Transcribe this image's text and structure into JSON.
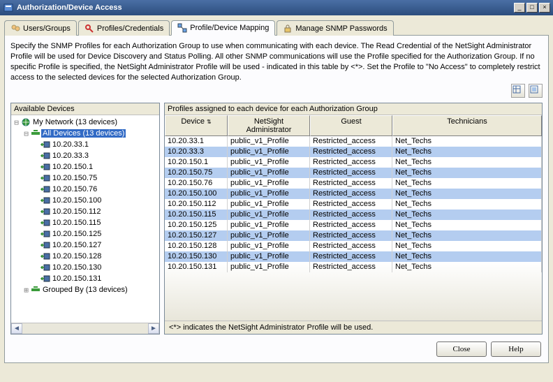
{
  "window": {
    "title": "Authorization/Device Access"
  },
  "tabs": [
    {
      "label": "Users/Groups"
    },
    {
      "label": "Profiles/Credentials"
    },
    {
      "label": "Profile/Device Mapping"
    },
    {
      "label": "Manage SNMP Passwords"
    }
  ],
  "description": "Specify the SNMP Profiles for each Authorization Group to use when communicating with each device.  The Read Credential of the NetSight Administrator Profile will be used for Device Discovery and Status Polling.  All other SNMP communications will use the Profile specified for the Authorization Group.  If no specific Profile is specified, the NetSight Administrator Profile will be used - indicated in this table by <*>.  Set the Profile to \"No Access\" to completely restrict access to the selected devices for the selected Authorization Group.",
  "left_header": "Available Devices",
  "right_header": "Profiles assigned to each device for each Authorization Group",
  "tree": {
    "root": "My Network (13 devices)",
    "all_devices": "All Devices (13 devices)",
    "devices": [
      "10.20.33.1",
      "10.20.33.3",
      "10.20.150.1",
      "10.20.150.75",
      "10.20.150.76",
      "10.20.150.100",
      "10.20.150.112",
      "10.20.150.115",
      "10.20.150.125",
      "10.20.150.127",
      "10.20.150.128",
      "10.20.150.130",
      "10.20.150.131"
    ],
    "grouped_by": "Grouped By (13 devices)"
  },
  "grid": {
    "headers": [
      "Device",
      "NetSight Administrator",
      "Guest",
      "Technicians"
    ],
    "rows": [
      {
        "device": "10.20.33.1",
        "admin": "public_v1_Profile",
        "guest": "Restricted_access",
        "tech": "Net_Techs"
      },
      {
        "device": "10.20.33.3",
        "admin": "public_v1_Profile",
        "guest": "Restricted_access",
        "tech": "Net_Techs"
      },
      {
        "device": "10.20.150.1",
        "admin": "public_v1_Profile",
        "guest": "Restricted_access",
        "tech": "Net_Techs"
      },
      {
        "device": "10.20.150.75",
        "admin": "public_v1_Profile",
        "guest": "Restricted_access",
        "tech": "Net_Techs"
      },
      {
        "device": "10.20.150.76",
        "admin": "public_v1_Profile",
        "guest": "Restricted_access",
        "tech": "Net_Techs"
      },
      {
        "device": "10.20.150.100",
        "admin": "public_v1_Profile",
        "guest": "Restricted_access",
        "tech": "Net_Techs"
      },
      {
        "device": "10.20.150.112",
        "admin": "public_v1_Profile",
        "guest": "Restricted_access",
        "tech": "Net_Techs"
      },
      {
        "device": "10.20.150.115",
        "admin": "public_v1_Profile",
        "guest": "Restricted_access",
        "tech": "Net_Techs"
      },
      {
        "device": "10.20.150.125",
        "admin": "public_v1_Profile",
        "guest": "Restricted_access",
        "tech": "Net_Techs"
      },
      {
        "device": "10.20.150.127",
        "admin": "public_v1_Profile",
        "guest": "Restricted_access",
        "tech": "Net_Techs"
      },
      {
        "device": "10.20.150.128",
        "admin": "public_v1_Profile",
        "guest": "Restricted_access",
        "tech": "Net_Techs"
      },
      {
        "device": "10.20.150.130",
        "admin": "public_v1_Profile",
        "guest": "Restricted_access",
        "tech": "Net_Techs"
      },
      {
        "device": "10.20.150.131",
        "admin": "public_v1_Profile",
        "guest": "Restricted_access",
        "tech": "Net_Techs"
      }
    ]
  },
  "footnote": "<*> indicates the NetSight Administrator Profile will be used.",
  "buttons": {
    "close": "Close",
    "help": "Help"
  }
}
